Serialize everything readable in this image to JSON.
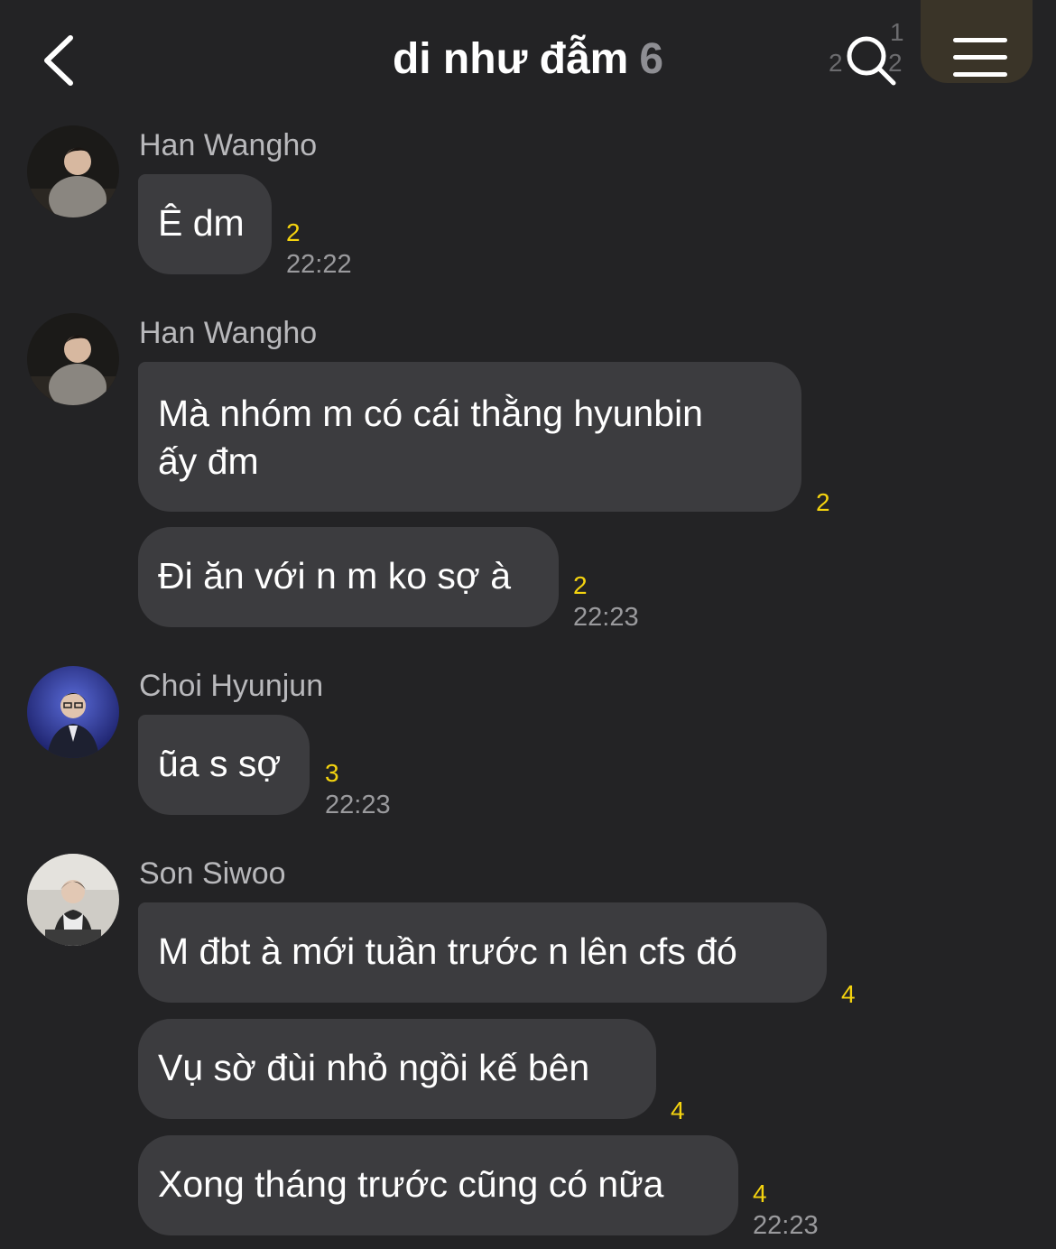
{
  "header": {
    "title": "di như đẫm",
    "member_count": "6",
    "ghost_badge_1": "1",
    "ghost_badge_2": "2",
    "ghost_badge_3": "2"
  },
  "colors": {
    "background": "#232325",
    "bubble": "#3c3c3f",
    "unread": "#f4d30f",
    "time": "#9a9a9d"
  },
  "messages": [
    {
      "sender": "Han Wangho",
      "avatar": "han-wangho-avatar",
      "bubbles": [
        {
          "text": "Ê dm",
          "unread": "2",
          "time": "22:22"
        }
      ]
    },
    {
      "sender": "Han Wangho",
      "avatar": "han-wangho-avatar",
      "bubbles": [
        {
          "line1": "Mà nhóm m có cái thằng hyunbin",
          "line2": "ấy đm",
          "unread": "2"
        },
        {
          "text": "Đi ăn với n m ko sợ à",
          "unread": "2",
          "time": "22:23"
        }
      ]
    },
    {
      "sender": "Choi Hyunjun",
      "avatar": "choi-hyunjun-avatar",
      "bubbles": [
        {
          "text": "ũa s sợ",
          "unread": "3",
          "time": "22:23"
        }
      ]
    },
    {
      "sender": "Son Siwoo",
      "avatar": "son-siwoo-avatar",
      "bubbles": [
        {
          "text": "M đbt à mới tuần trước n lên cfs đó",
          "unread": "4"
        },
        {
          "text": "Vụ sờ đùi nhỏ ngồi kế bên",
          "unread": "4"
        },
        {
          "text": "Xong tháng trước cũng có nữa",
          "unread": "4",
          "time": "22:23"
        }
      ]
    }
  ]
}
